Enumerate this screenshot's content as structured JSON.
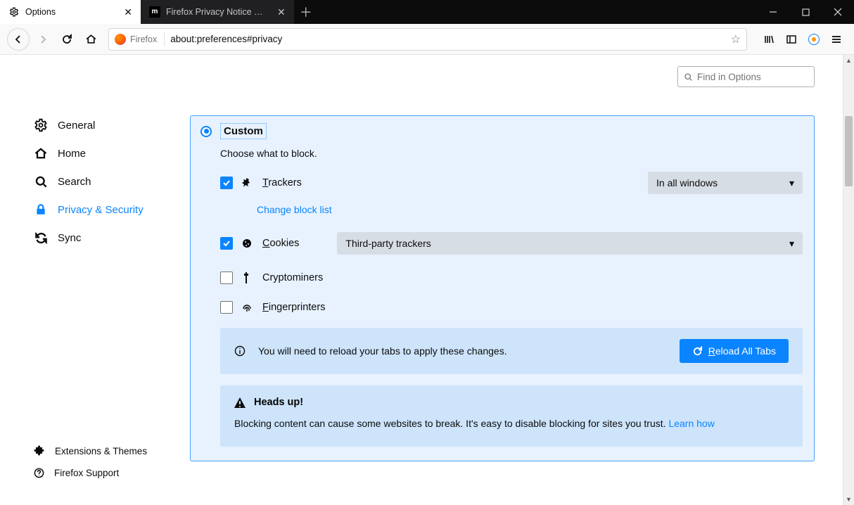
{
  "window": {
    "tabs": [
      {
        "label": "Options",
        "active": true
      },
      {
        "label": "Firefox Privacy Notice — Mozil",
        "active": false
      }
    ]
  },
  "urlbar": {
    "identity": "Firefox",
    "url": "about:preferences#privacy"
  },
  "search": {
    "placeholder": "Find in Options"
  },
  "sidebar": {
    "items": [
      {
        "label": "General"
      },
      {
        "label": "Home"
      },
      {
        "label": "Search"
      },
      {
        "label": "Privacy & Security"
      },
      {
        "label": "Sync"
      }
    ],
    "footer": [
      {
        "label": "Extensions & Themes"
      },
      {
        "label": "Firefox Support"
      }
    ]
  },
  "panel": {
    "title": "Custom",
    "desc": "Choose what to block.",
    "trackers": {
      "label": "Trackers",
      "select": "In all windows",
      "link": "Change block list"
    },
    "cookies": {
      "label": "Cookies",
      "select": "Third-party trackers"
    },
    "crypto": {
      "label": "Cryptominers"
    },
    "finger": {
      "label": "Fingerprinters"
    },
    "reload": {
      "msg": "You will need to reload your tabs to apply these changes.",
      "button": "Reload All Tabs"
    },
    "warn": {
      "head": "Heads up!",
      "msg": "Blocking content can cause some websites to break. It's easy to disable blocking for sites you trust.  ",
      "link": "Learn how"
    }
  }
}
